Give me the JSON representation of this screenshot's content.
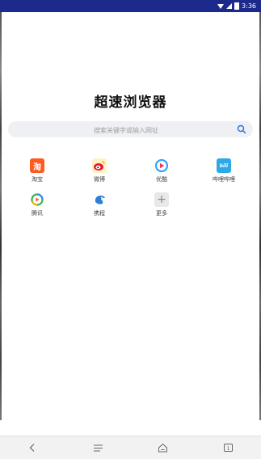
{
  "status_bar": {
    "time": "3:36"
  },
  "app": {
    "title": "超速浏览器"
  },
  "search": {
    "placeholder": "搜索关键字或输入网址"
  },
  "shortcuts": [
    {
      "label": "淘宝",
      "icon": "taobao-icon",
      "glyph": "淘",
      "color": "#ff5a1f"
    },
    {
      "label": "微博",
      "icon": "weibo-icon",
      "glyph": "",
      "color": "#f5c518"
    },
    {
      "label": "优酷",
      "icon": "youku-icon",
      "glyph": "",
      "color": "#2ea6ff"
    },
    {
      "label": "哔哩哔哩",
      "icon": "bilibili-icon",
      "glyph": "bili",
      "color": "#2fa8e8"
    },
    {
      "label": "腾讯",
      "icon": "tencent-icon",
      "glyph": "",
      "color": "#3aa63a"
    },
    {
      "label": "携程",
      "icon": "ctrip-icon",
      "glyph": "",
      "color": "#2b7fd6"
    },
    {
      "label": "更多",
      "icon": "plus-icon",
      "glyph": "+",
      "color": "#e6e6e6"
    }
  ],
  "nav": [
    "back-icon",
    "menu-icon",
    "home-icon",
    "tabs-icon"
  ],
  "nav_tabs_count": "1"
}
